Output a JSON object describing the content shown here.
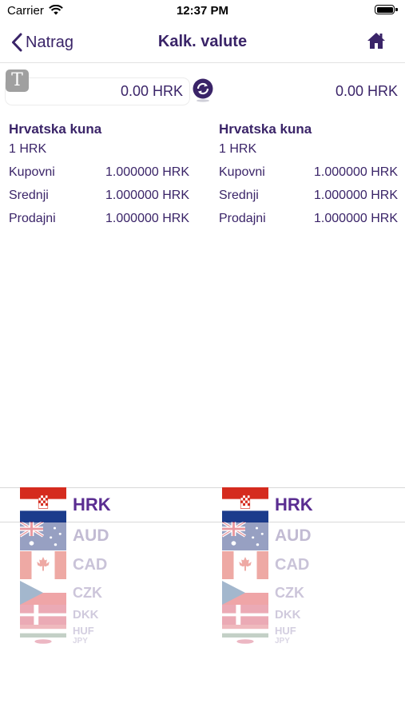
{
  "status_bar": {
    "carrier": "Carrier",
    "time": "12:37 PM"
  },
  "nav": {
    "back_label": "Natrag",
    "title": "Kalk. valute"
  },
  "converter": {
    "input_value": "0.00 HRK",
    "result_value": "0.00 HRK",
    "text_toggle": "T"
  },
  "from_currency": {
    "name": "Hrvatska kuna",
    "unit": "1 HRK",
    "rates": [
      {
        "label": "Kupovni",
        "value": "1.000000 HRK"
      },
      {
        "label": "Srednji",
        "value": "1.000000 HRK"
      },
      {
        "label": "Prodajni",
        "value": "1.000000 HRK"
      }
    ]
  },
  "to_currency": {
    "name": "Hrvatska kuna",
    "unit": "1 HRK",
    "rates": [
      {
        "label": "Kupovni",
        "value": "1.000000 HRK"
      },
      {
        "label": "Srednji",
        "value": "1.000000 HRK"
      },
      {
        "label": "Prodajni",
        "value": "1.000000 HRK"
      }
    ]
  },
  "picker": {
    "items": [
      {
        "code": "HRK",
        "flag": "croatia-flag-icon",
        "selected": true
      },
      {
        "code": "AUD",
        "flag": "australia-flag-icon"
      },
      {
        "code": "CAD",
        "flag": "canada-flag-icon"
      },
      {
        "code": "CZK",
        "flag": "czech-flag-icon"
      },
      {
        "code": "DKK",
        "flag": "denmark-flag-icon"
      },
      {
        "code": "HUF",
        "flag": "hungary-flag-icon"
      },
      {
        "code": "JPY",
        "flag": "japan-flag-icon"
      }
    ]
  },
  "colors": {
    "brand": "#3a2468",
    "accent": "#5a2d91"
  }
}
